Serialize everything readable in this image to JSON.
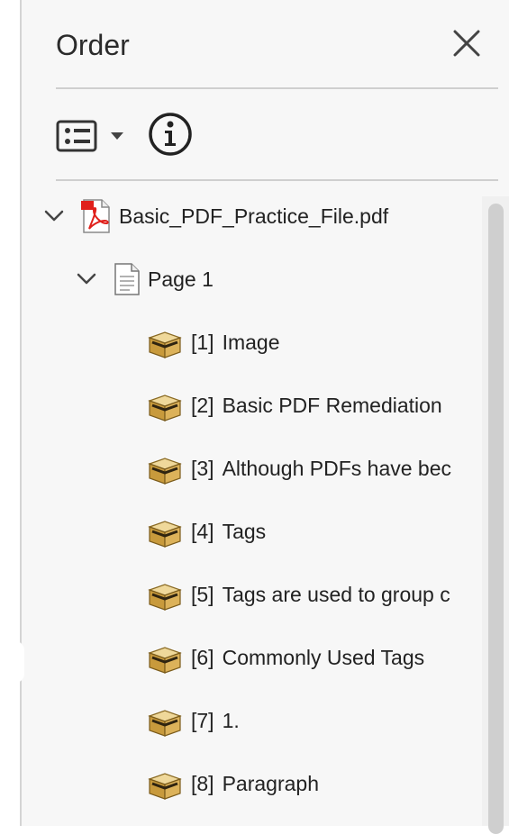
{
  "panel": {
    "title": "Order",
    "close_icon": "close-icon",
    "toolbar": {
      "options_icon": "list-options-icon",
      "dropdown_icon": "caret-down-icon",
      "info_icon": "info-icon"
    }
  },
  "tree": {
    "file": {
      "label": "Basic_PDF_Practice_File.pdf",
      "icon": "pdf-file-icon"
    },
    "page": {
      "label": "Page 1",
      "icon": "page-icon"
    },
    "items": [
      {
        "num": "[1]",
        "text": "Image"
      },
      {
        "num": "[2]",
        "text": "Basic PDF Remediation"
      },
      {
        "num": "[3]",
        "text": "Although PDFs have bec"
      },
      {
        "num": "[4]",
        "text": "Tags"
      },
      {
        "num": "[5]",
        "text": "Tags are used to group c"
      },
      {
        "num": "[6]",
        "text": "Commonly Used Tags"
      },
      {
        "num": "[7]",
        "text": "1."
      },
      {
        "num": "[8]",
        "text": "Paragraph"
      }
    ],
    "item_icon": "content-box-icon"
  },
  "colors": {
    "panel_bg": "#f7f7f7",
    "divider": "#cfcfcf",
    "pdf_red": "#e0201b",
    "box_tan": "#d9b45a"
  }
}
